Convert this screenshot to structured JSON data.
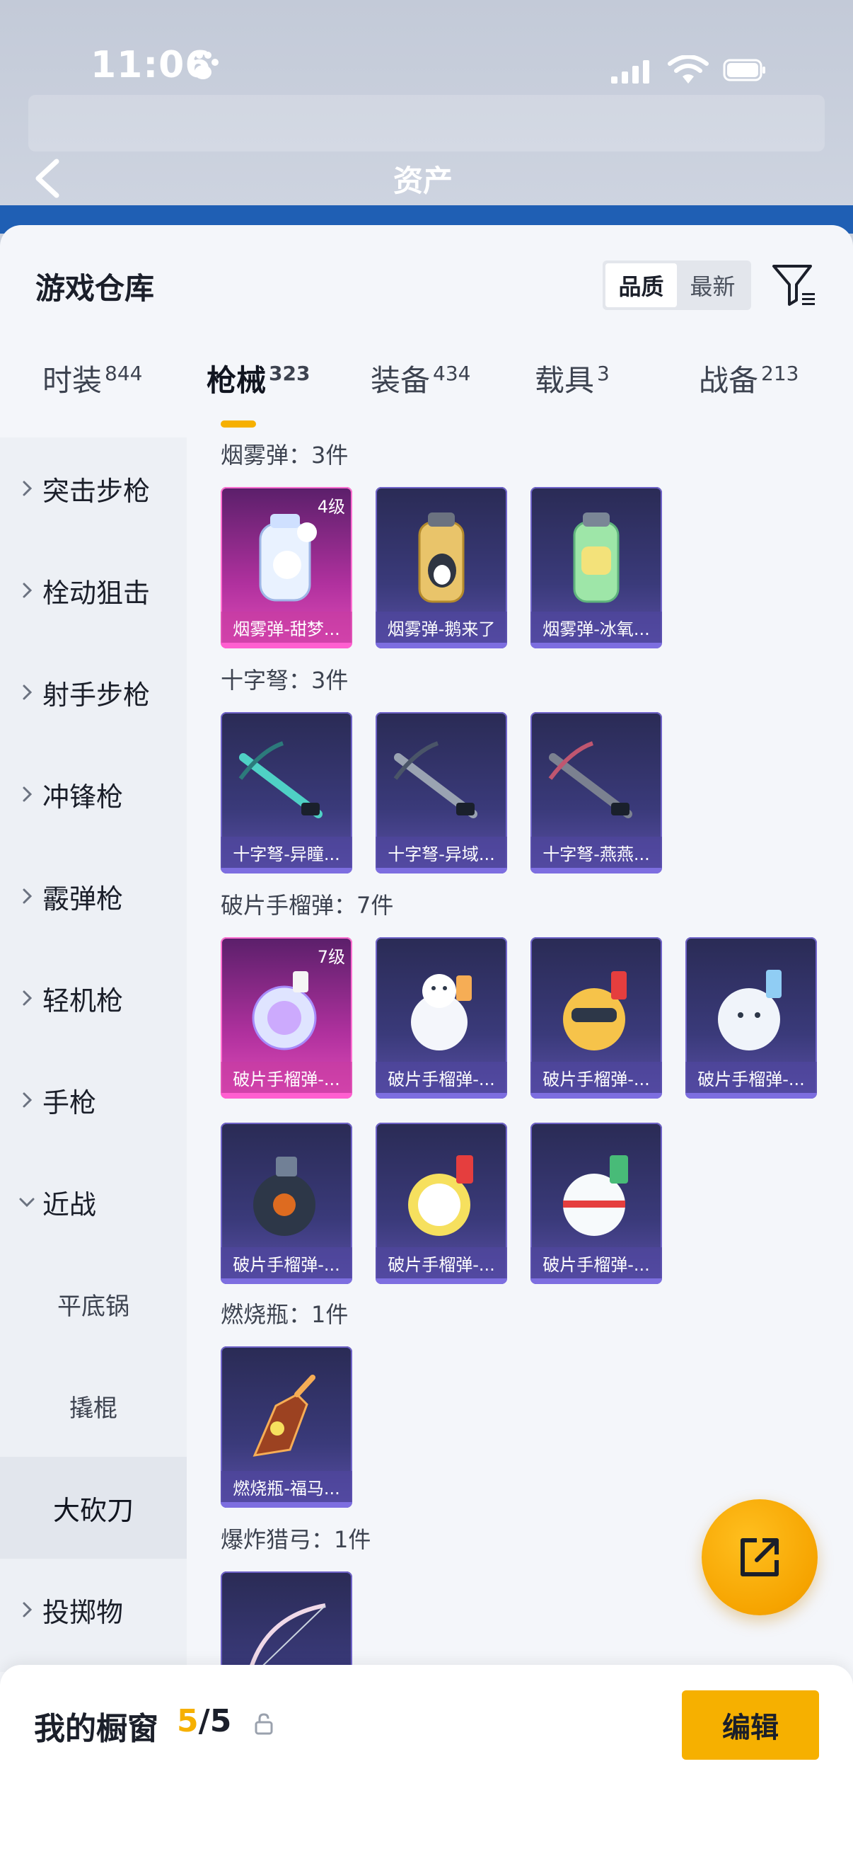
{
  "status_bar": {
    "time": "11:06"
  },
  "background": {
    "title": "资产"
  },
  "sheet": {
    "title": "游戏仓库",
    "sort_options": [
      "品质",
      "最新"
    ],
    "active_sort": "品质"
  },
  "tabs": [
    {
      "label": "时装",
      "count": "844"
    },
    {
      "label": "枪械",
      "count": "323"
    },
    {
      "label": "装备",
      "count": "434"
    },
    {
      "label": "载具",
      "count": "3"
    },
    {
      "label": "战备",
      "count": "213"
    }
  ],
  "sidenav": [
    {
      "label": "突击步枪",
      "type": "group"
    },
    {
      "label": "栓动狙击",
      "type": "group"
    },
    {
      "label": "射手步枪",
      "type": "group"
    },
    {
      "label": "冲锋枪",
      "type": "group"
    },
    {
      "label": "霰弹枪",
      "type": "group"
    },
    {
      "label": "轻机枪",
      "type": "group"
    },
    {
      "label": "手枪",
      "type": "group"
    },
    {
      "label": "近战",
      "type": "group-open"
    },
    {
      "label": "平底锅",
      "type": "sub"
    },
    {
      "label": "撬棍",
      "type": "sub"
    },
    {
      "label": "大砍刀",
      "type": "selected"
    },
    {
      "label": "投掷物",
      "type": "group"
    }
  ],
  "sections": [
    {
      "title": "烟雾弹：3件",
      "items": [
        {
          "name": "烟雾弹-甜梦...",
          "level": "4级",
          "rarity": "pink"
        },
        {
          "name": "烟雾弹-鹅来了",
          "rarity": "purple"
        },
        {
          "name": "烟雾弹-冰氧...",
          "rarity": "purple"
        }
      ]
    },
    {
      "title": "十字弩：3件",
      "items": [
        {
          "name": "十字弩-异瞳...",
          "rarity": "purple"
        },
        {
          "name": "十字弩-异域...",
          "rarity": "purple"
        },
        {
          "name": "十字弩-燕燕...",
          "rarity": "purple"
        }
      ]
    },
    {
      "title": "破片手榴弹：7件",
      "items": [
        {
          "name": "破片手榴弹-...",
          "level": "7级",
          "rarity": "pink"
        },
        {
          "name": "破片手榴弹-...",
          "rarity": "purple"
        },
        {
          "name": "破片手榴弹-...",
          "rarity": "purple"
        },
        {
          "name": "破片手榴弹-...",
          "rarity": "purple"
        },
        {
          "name": "破片手榴弹-...",
          "rarity": "purple"
        },
        {
          "name": "破片手榴弹-...",
          "rarity": "purple"
        },
        {
          "name": "破片手榴弹-...",
          "rarity": "purple"
        }
      ]
    },
    {
      "title": "燃烧瓶：1件",
      "items": [
        {
          "name": "燃烧瓶-福马...",
          "rarity": "purple"
        }
      ]
    },
    {
      "title": "爆炸猎弓：1件",
      "items": [
        {
          "name": "",
          "rarity": "purple"
        }
      ]
    }
  ],
  "bottom_bar": {
    "title": "我的橱窗",
    "current": "5",
    "total": "/5",
    "edit_label": "编辑"
  },
  "colors": {
    "accent": "#f6b000",
    "pink_rarity": "#e14cb8",
    "purple_rarity": "#5b50a8"
  }
}
